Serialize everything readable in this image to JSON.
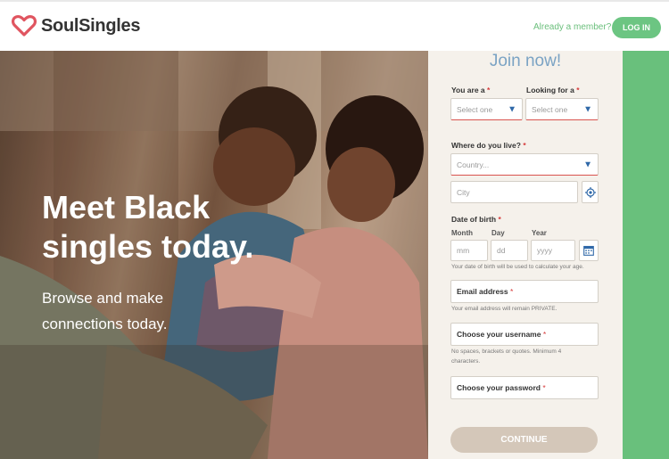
{
  "brand": {
    "name": "SoulSingles",
    "accent": "#e05560",
    "green": "#6cc582"
  },
  "header": {
    "member_text": "Already a member?",
    "login_label": "LOG IN"
  },
  "hero": {
    "title": "Meet Black singles today.",
    "subtitle": "Browse and make connections today."
  },
  "form": {
    "heading": "Join now!",
    "you_are": {
      "label": "You are a",
      "required": "*",
      "placeholder": "Select one"
    },
    "looking_for": {
      "label": "Looking for a",
      "required": "*",
      "placeholder": "Select one"
    },
    "location": {
      "label": "Where do you live?",
      "required": "*",
      "country_placeholder": "Country...",
      "city_placeholder": "City"
    },
    "dob": {
      "label": "Date of birth",
      "required": "*",
      "month_label": "Month",
      "day_label": "Day",
      "year_label": "Year",
      "month_placeholder": "mm",
      "day_placeholder": "dd",
      "year_placeholder": "yyyy",
      "help": "Your date of birth will be used to calculate your age."
    },
    "email": {
      "label": "Email address",
      "required": "*",
      "help": "Your email address will remain PRIVATE."
    },
    "username": {
      "label": "Choose your username",
      "required": "*",
      "help": "No spaces, brackets or quotes. Minimum 4 characters."
    },
    "password": {
      "label": "Choose your password",
      "required": "*"
    },
    "continue_label": "CONTINUE"
  },
  "icons": {
    "logo": "heart-outline-icon",
    "select": "chevron-down-icon",
    "locate": "crosshair-icon",
    "calendar": "calendar-icon"
  }
}
